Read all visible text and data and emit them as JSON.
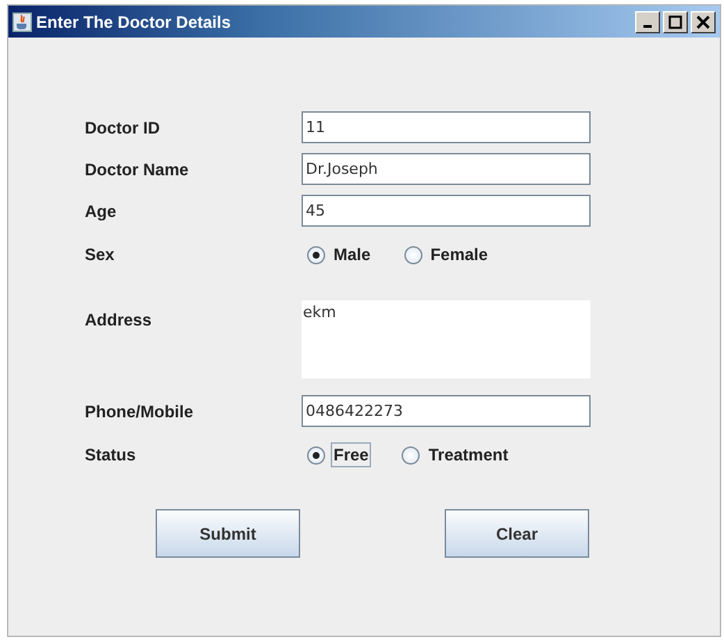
{
  "window": {
    "title": "Enter The Doctor Details"
  },
  "fields": [
    {
      "kind": "text",
      "label": "Doctor ID",
      "value": "11"
    },
    {
      "kind": "text",
      "label": "Doctor Name",
      "value": "Dr.Joseph"
    },
    {
      "kind": "text",
      "label": "Age",
      "value": "45"
    },
    {
      "kind": "radio",
      "label": "Sex",
      "options": [
        {
          "label": "Male",
          "selected": true,
          "focused": false
        },
        {
          "label": "Female",
          "selected": false,
          "focused": false
        }
      ]
    },
    {
      "kind": "textarea",
      "label": "Address",
      "value": "ekm"
    },
    {
      "kind": "text",
      "label": "Phone/Mobile",
      "value": "0486422273"
    },
    {
      "kind": "radio",
      "label": "Status",
      "options": [
        {
          "label": "Free",
          "selected": true,
          "focused": true
        },
        {
          "label": "Treatment",
          "selected": false,
          "focused": false
        }
      ]
    }
  ],
  "buttons": [
    "Submit",
    "Clear"
  ]
}
